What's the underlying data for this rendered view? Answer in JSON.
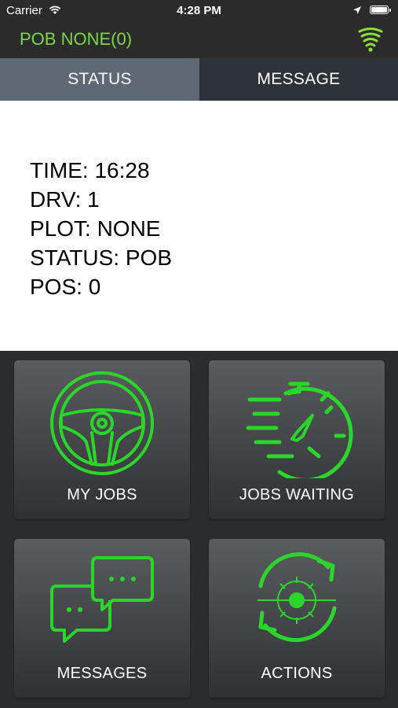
{
  "status_bar": {
    "carrier": "Carrier",
    "time": "4:28 PM"
  },
  "header": {
    "title": "POB NONE(0)",
    "accent_color": "#7ad64a"
  },
  "tabs": [
    {
      "label": "STATUS",
      "selected": true
    },
    {
      "label": "MESSAGE",
      "selected": false
    }
  ],
  "info": {
    "time": "TIME: 16:28",
    "drv": "DRV: 1",
    "plot": "PLOT: NONE",
    "status": "STATUS: POB",
    "pos": "POS: 0"
  },
  "tiles": [
    {
      "label": "MY JOBS",
      "icon": "steering-wheel-icon"
    },
    {
      "label": "JOBS WAITING",
      "icon": "stopwatch-icon"
    },
    {
      "label": "MESSAGES",
      "icon": "chat-bubbles-icon"
    },
    {
      "label": "ACTIONS",
      "icon": "gear-cycle-icon"
    }
  ],
  "icon_color": "#2bd62b"
}
